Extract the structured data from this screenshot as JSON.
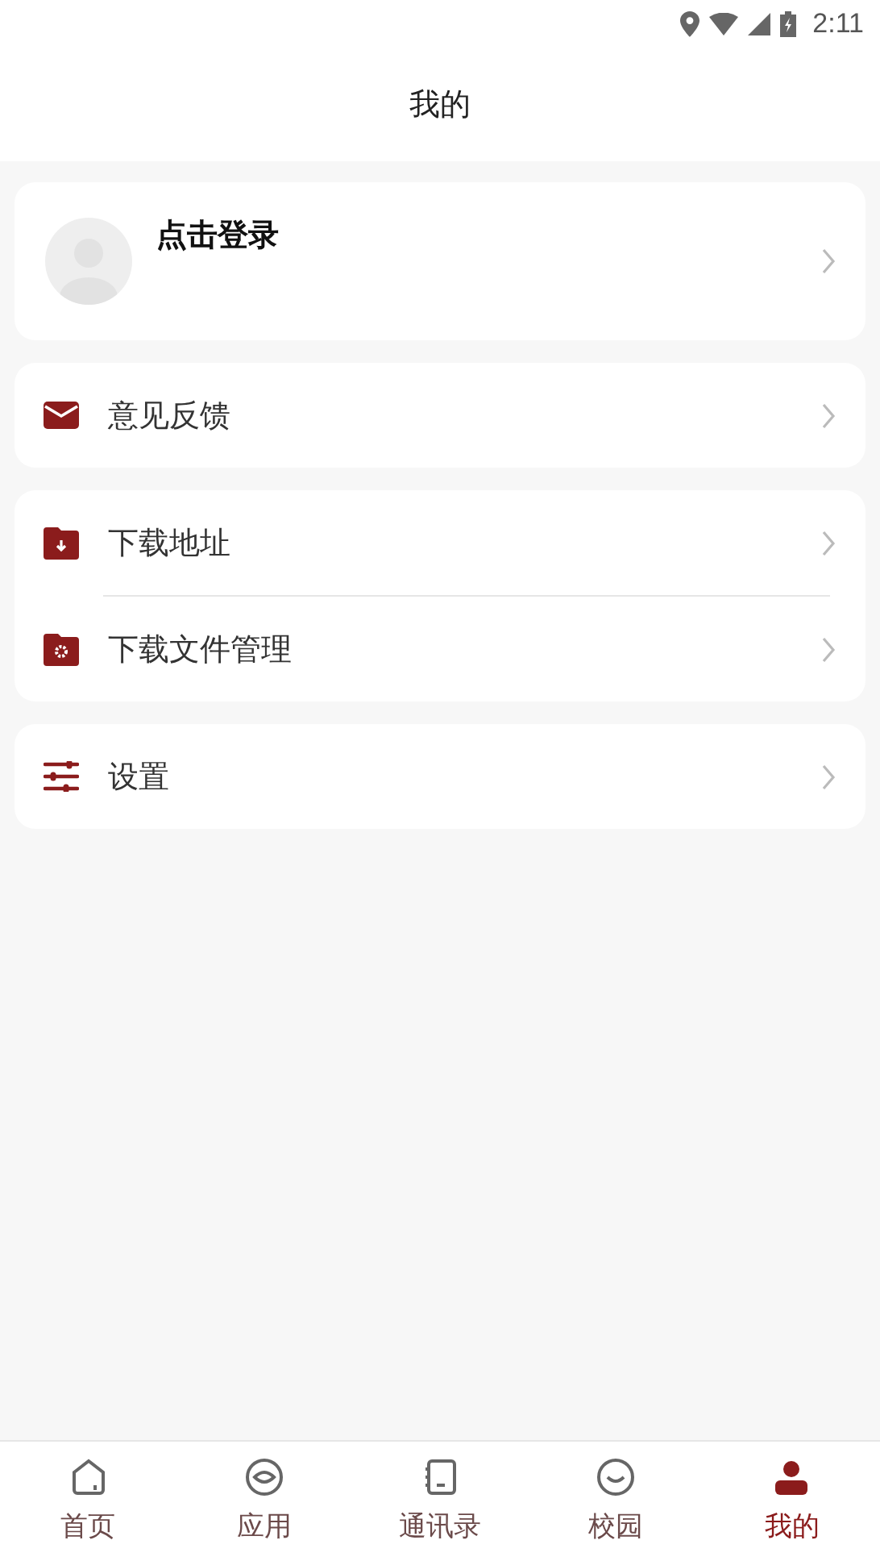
{
  "status_bar": {
    "time": "2:11"
  },
  "header": {
    "title": "我的"
  },
  "profile": {
    "login_label": "点击登录"
  },
  "menu_groups": [
    {
      "items": [
        {
          "label": "意见反馈"
        }
      ]
    },
    {
      "items": [
        {
          "label": "下载地址"
        },
        {
          "label": "下载文件管理"
        }
      ]
    },
    {
      "items": [
        {
          "label": "设置"
        }
      ]
    }
  ],
  "tab_bar": [
    {
      "label": "首页",
      "selected": false
    },
    {
      "label": "应用",
      "selected": false
    },
    {
      "label": "通讯录",
      "selected": false
    },
    {
      "label": "校园",
      "selected": false
    },
    {
      "label": "我的",
      "selected": true
    }
  ]
}
